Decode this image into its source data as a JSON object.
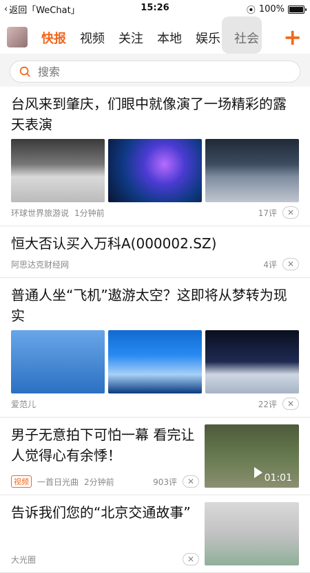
{
  "status_bar": {
    "back_label": "返回「WeChat」",
    "time": "15:26",
    "battery": "100%",
    "battery_level": 1.0
  },
  "nav": {
    "tabs": [
      {
        "label": "快报",
        "active": true
      },
      {
        "label": "视频",
        "active": false
      },
      {
        "label": "关注",
        "active": false
      },
      {
        "label": "本地",
        "active": false
      },
      {
        "label": "娱乐",
        "active": false
      },
      {
        "label": "社会",
        "active": false
      }
    ],
    "plus_symbol": "+",
    "accent_color": "#f2671c"
  },
  "search": {
    "placeholder": "搜索",
    "icon": "search-icon"
  },
  "feed": [
    {
      "title": "台风来到肇庆，们眼中就像演了一场精彩的露天表演",
      "source": "环球世界旅游说",
      "time": "1分钟前",
      "comments": "17评",
      "images": [
        "img1",
        "img2",
        "img3"
      ]
    },
    {
      "title": "恒大否认买入万科A(000002.SZ)",
      "source": "阿思达克财经网",
      "comments": "4评"
    },
    {
      "title": "普通人坐“飞机”遨游太空？这即将从梦转为现实",
      "source": "爱范儿",
      "comments": "22评",
      "images": [
        "img4",
        "img5",
        "img6"
      ]
    },
    {
      "title": "男子无意拍下可怕一幕 看完让人觉得心有余悸！",
      "tag": "视频",
      "source": "一首日光曲",
      "time": "2分钟前",
      "comments": "903评",
      "duration": "01:01"
    },
    {
      "title": "告诉我们您的“北京交通故事”",
      "source": "大光圈"
    }
  ]
}
